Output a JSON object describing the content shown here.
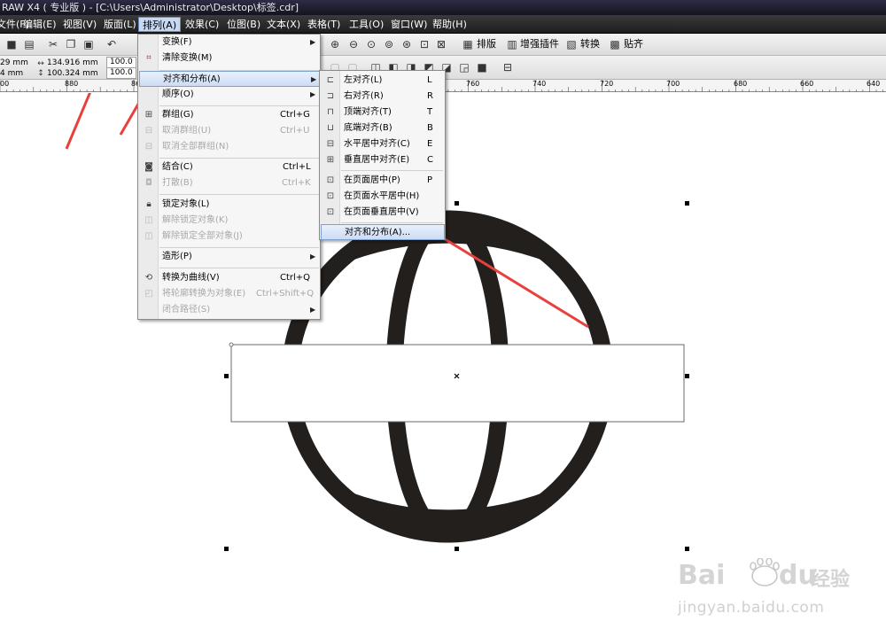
{
  "title_bar": {
    "text": "RAW X4 ( 专业版 ) - [C:\\Users\\Administrator\\Desktop\\标签.cdr]"
  },
  "menubar": {
    "items": [
      {
        "label": "文件(F)"
      },
      {
        "label": "编辑(E)"
      },
      {
        "label": "视图(V)"
      },
      {
        "label": "版面(L)"
      },
      {
        "label": "排列(A)"
      },
      {
        "label": "效果(C)"
      },
      {
        "label": "位图(B)"
      },
      {
        "label": "文本(X)"
      },
      {
        "label": "表格(T)"
      },
      {
        "label": "工具(O)"
      },
      {
        "label": "窗口(W)"
      },
      {
        "label": "帮助(H)"
      }
    ]
  },
  "toolbar": {
    "arrange_label": "排版",
    "plugin_label": "增强插件",
    "convert_label": "转换",
    "align_label": "贴齐",
    "pos_x_value": "29 mm",
    "pos_y_value": "4 mm",
    "width_value": "134.916 mm",
    "height_value": "100.324 mm",
    "scale_x_value": "100.0",
    "scale_y_value": "100.0"
  },
  "ruler": {
    "labels": [
      "00",
      "880",
      "86",
      "760",
      "740",
      "720",
      "700",
      "680",
      "660",
      "640"
    ]
  },
  "arrange_menu": {
    "items": [
      {
        "label": "变换(F)",
        "icon": "transform-icon",
        "shortcut": "",
        "submenu": true,
        "disabled": false
      },
      {
        "label": "清除变换(M)",
        "icon": "clear-transform-icon",
        "shortcut": "",
        "submenu": false,
        "disabled": false
      },
      {
        "label": "对齐和分布(A)",
        "icon": "",
        "shortcut": "",
        "submenu": true,
        "disabled": false,
        "highlighted": true
      },
      {
        "label": "顺序(O)",
        "icon": "",
        "shortcut": "",
        "submenu": true,
        "disabled": false
      },
      {
        "label": "群组(G)",
        "icon": "group-icon",
        "shortcut": "Ctrl+G",
        "submenu": false,
        "disabled": false
      },
      {
        "label": "取消群组(U)",
        "icon": "ungroup-icon",
        "shortcut": "Ctrl+U",
        "submenu": false,
        "disabled": true
      },
      {
        "label": "取消全部群组(N)",
        "icon": "ungroup-all-icon",
        "shortcut": "",
        "submenu": false,
        "disabled": true
      },
      {
        "label": "结合(C)",
        "icon": "combine-icon",
        "shortcut": "Ctrl+L",
        "submenu": false,
        "disabled": false
      },
      {
        "label": "打散(B)",
        "icon": "break-apart-icon",
        "shortcut": "Ctrl+K",
        "submenu": false,
        "disabled": true
      },
      {
        "label": "锁定对象(L)",
        "icon": "lock-icon",
        "shortcut": "",
        "submenu": false,
        "disabled": false
      },
      {
        "label": "解除锁定对象(K)",
        "icon": "unlock-icon",
        "shortcut": "",
        "submenu": false,
        "disabled": true
      },
      {
        "label": "解除锁定全部对象(J)",
        "icon": "unlock-all-icon",
        "shortcut": "",
        "submenu": false,
        "disabled": true
      },
      {
        "label": "造形(P)",
        "icon": "",
        "shortcut": "",
        "submenu": true,
        "disabled": false
      },
      {
        "label": "转换为曲线(V)",
        "icon": "convert-curves-icon",
        "shortcut": "Ctrl+Q",
        "submenu": false,
        "disabled": false
      },
      {
        "label": "将轮廓转换为对象(E)",
        "icon": "outline-to-object-icon",
        "shortcut": "Ctrl+Shift+Q",
        "submenu": false,
        "disabled": true
      },
      {
        "label": "闭合路径(S)",
        "icon": "",
        "shortcut": "",
        "submenu": true,
        "disabled": true
      }
    ]
  },
  "align_submenu": {
    "items": [
      {
        "label": "左对齐(L)",
        "icon": "align-left-icon",
        "shortcut": "L"
      },
      {
        "label": "右对齐(R)",
        "icon": "align-right-icon",
        "shortcut": "R"
      },
      {
        "label": "顶端对齐(T)",
        "icon": "align-top-icon",
        "shortcut": "T"
      },
      {
        "label": "底端对齐(B)",
        "icon": "align-bottom-icon",
        "shortcut": "B"
      },
      {
        "label": "水平居中对齐(C)",
        "icon": "align-hcenter-icon",
        "shortcut": "E"
      },
      {
        "label": "垂直居中对齐(E)",
        "icon": "align-vcenter-icon",
        "shortcut": "C"
      },
      {
        "label": "在页面居中(P)",
        "icon": "center-page-icon",
        "shortcut": "P"
      },
      {
        "label": "在页面水平居中(H)",
        "icon": "center-page-h-icon",
        "shortcut": ""
      },
      {
        "label": "在页面垂直居中(V)",
        "icon": "center-page-v-icon",
        "shortcut": ""
      },
      {
        "label": "对齐和分布(A)...",
        "icon": "",
        "shortcut": "",
        "highlighted": true
      }
    ]
  },
  "watermark": {
    "logo_text": "Bai",
    "logo_text2": "du",
    "brand_cn": "经验",
    "url": "jingyan.baidu.com"
  },
  "colors": {
    "globe": "#231f1c",
    "arrow": "#e8413c",
    "menu_highlight": "#cddcf4"
  }
}
